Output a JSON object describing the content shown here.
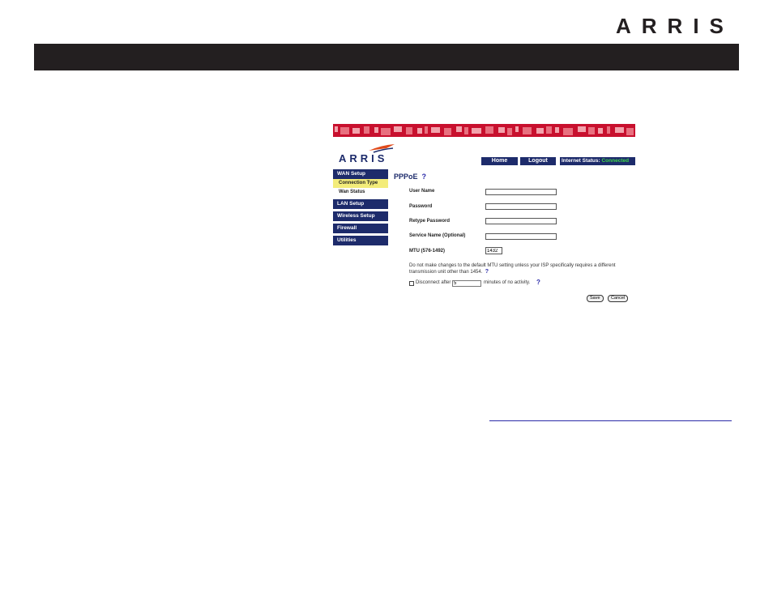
{
  "page": {
    "brand": "ARRIS",
    "colors": {
      "header_bar": "#231f20",
      "nav_blue": "#1d2b6b",
      "banner_red": "#c8102e",
      "active_yellow": "#f3ec7a",
      "status_green": "#3fd64b"
    }
  },
  "screenshot": {
    "logo_text": "ARRIS",
    "nav": {
      "home": "Home",
      "logout": "Logout"
    },
    "status": {
      "label": "Internet Status:",
      "value": "Connected"
    },
    "sidebar": {
      "wan_setup": "WAN Setup",
      "connection_type": "Connection Type",
      "wan_status": "Wan Status",
      "lan_setup": "LAN Setup",
      "wireless_setup": "Wireless Setup",
      "firewall": "Firewall",
      "utilities": "Utilities"
    },
    "form": {
      "title": "PPPoE",
      "help": "?",
      "user_name": "User Name",
      "password": "Password",
      "retype_password": "Retype Password",
      "service_name": "Service Name (Optional)",
      "mtu_label": "MTU (576-1492)",
      "mtu_value": "1432",
      "note": "Do not make changes to the default MTU setting unless your ISP specifically requires a different transmission unit other than 1454.",
      "disconnect_label": "Disconnect after",
      "disconnect_value": "5",
      "disconnect_suffix": "minutes of no activity.",
      "save": "Save",
      "cancel": "Cancel"
    }
  }
}
